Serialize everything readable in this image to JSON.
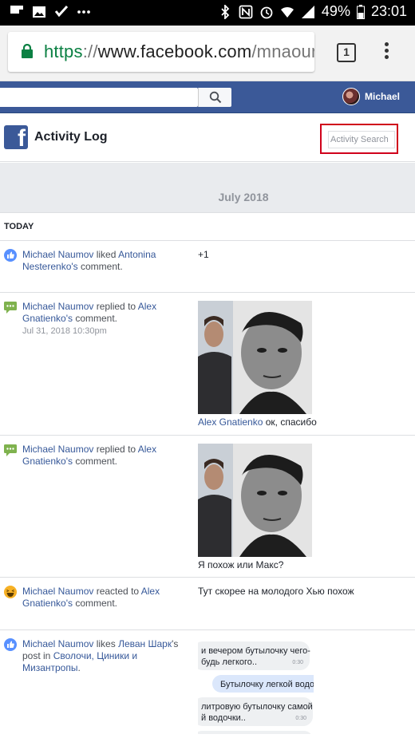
{
  "status_bar": {
    "battery": "49%",
    "time": "23:01"
  },
  "browser": {
    "url_scheme": "https",
    "url_sep": "://",
    "url_host": "www.facebook.com",
    "url_path": "/mnaoum",
    "tab_count": "1"
  },
  "fb_header": {
    "user_name": "Michael"
  },
  "activity_log": {
    "title": "Activity Log",
    "search_placeholder": "Activity Search",
    "month": "July 2018",
    "section": "TODAY"
  },
  "entries": [
    {
      "actor": "Michael Naumov",
      "verb": " liked ",
      "target": "Antonina Nesterenko's",
      "object": " comment.",
      "right_text": "+1"
    },
    {
      "actor": "Michael Naumov",
      "verb": " replied to ",
      "target": "Alex Gnatienko's",
      "object": " comment.",
      "timestamp": "Jul 31, 2018 10:30pm",
      "caption_link": "Alex Gnatienko",
      "caption_text": " ок, спасибо"
    },
    {
      "actor": "Michael Naumov",
      "verb": " replied to ",
      "target": "Alex Gnatienko's",
      "object": " comment.",
      "caption_text": "Я похож или Макс?"
    },
    {
      "actor": "Michael Naumov",
      "verb": " reacted to ",
      "target": "Alex Gnatienko's",
      "object": " comment.",
      "right_text": "Тут скорее на молодого Хью похож"
    },
    {
      "actor": "Michael Naumov",
      "verb": " likes ",
      "target": "Леван Шарк",
      "mid": "'s post in ",
      "target2": "Сволочи, Циники и Мизантропы",
      "object": ".",
      "bubbles": [
        {
          "text": "и вечером бутылочку чего-",
          "text2": "будь легкого..",
          "time": "0:30"
        },
        {
          "text": "Бутылочку легкой водо",
          "time": ""
        },
        {
          "text": "литровую бутылочку самой",
          "text2": "й водочки..",
          "time": "0:30"
        },
        {
          "text": "",
          "time": ""
        }
      ]
    }
  ],
  "colors": {
    "fb_blue": "#3b5998",
    "link": "#365899",
    "highlight": "#d0021b"
  }
}
